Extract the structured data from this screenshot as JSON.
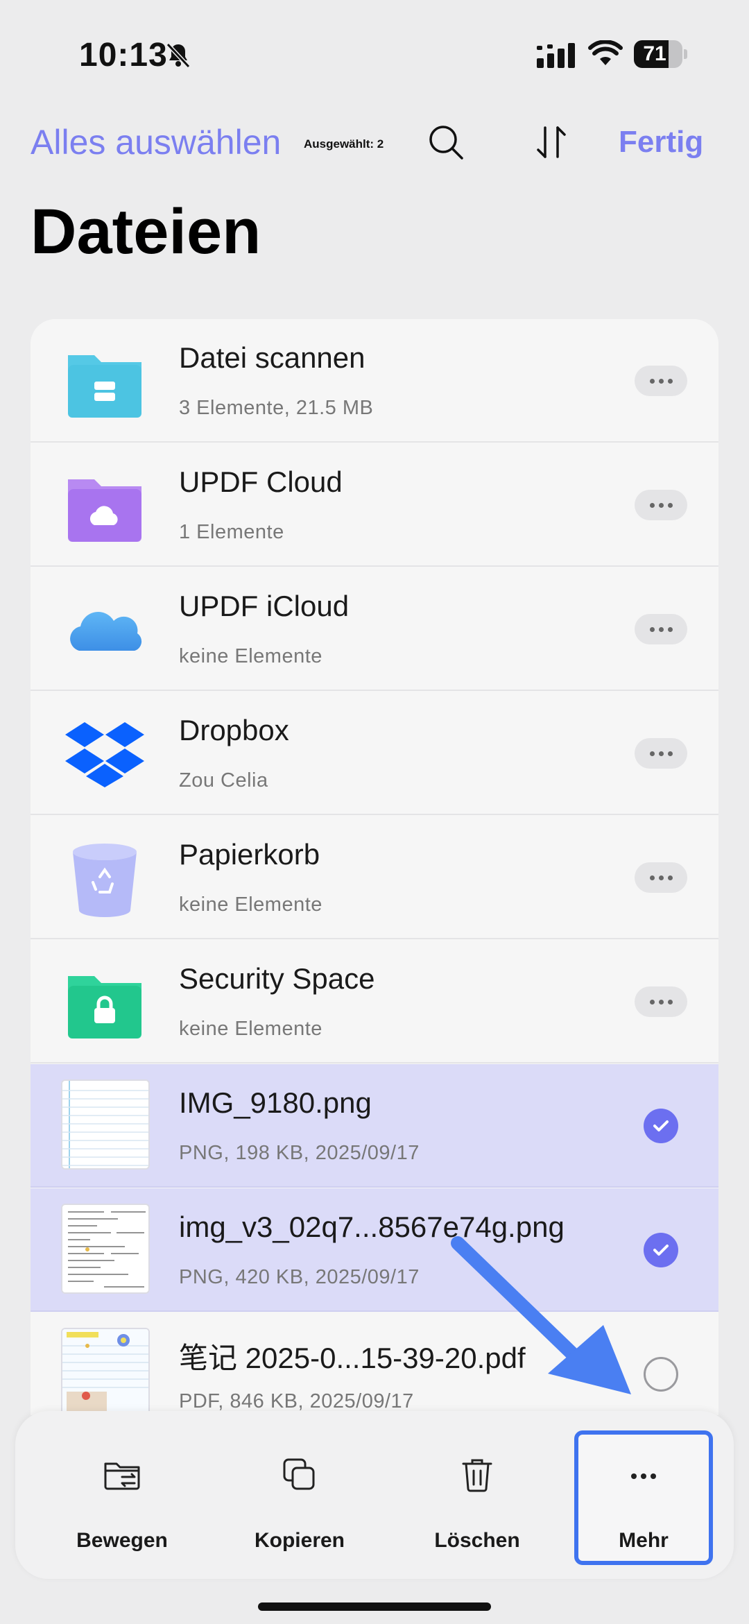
{
  "status": {
    "time": "10:13",
    "battery": "71",
    "battery_level": 0.71
  },
  "header": {
    "select_all": "Alles auswählen",
    "selected_count": "Ausgewählt: 2",
    "done": "Fertig",
    "title": "Dateien"
  },
  "rows": [
    {
      "title": "Datei scannen",
      "sub": "3 Elemente, 21.5 MB",
      "icon": "scan-folder-icon"
    },
    {
      "title": "UPDF Cloud",
      "sub": "1 Elemente",
      "icon": "cloud-folder-icon"
    },
    {
      "title": "UPDF iCloud",
      "sub": "keine Elemente",
      "icon": "icloud-icon"
    },
    {
      "title": "Dropbox",
      "sub": "Zou Celia",
      "icon": "dropbox-icon"
    },
    {
      "title": "Papierkorb",
      "sub": "keine Elemente",
      "icon": "trash-bin-icon"
    },
    {
      "title": "Security Space",
      "sub": "keine Elemente",
      "icon": "lock-folder-icon"
    },
    {
      "title": "IMG_9180.png",
      "sub": "PNG, 198 KB, 2025/09/17",
      "selected": true
    },
    {
      "title": "img_v3_02q7...8567e74g.png",
      "sub": "PNG, 420 KB, 2025/09/17",
      "selected": true
    },
    {
      "title": " 笔记 2025-0...15-39-20.pdf",
      "sub": "PDF, 846 KB, 2025/09/17",
      "selected": false
    }
  ],
  "toolbar": {
    "move": "Bewegen",
    "copy": "Kopieren",
    "delete": "Löschen",
    "more": "Mehr"
  },
  "colors": {
    "accent": "#7b7ff0",
    "selected_row": "#dbdbf8",
    "highlight_frame": "#3f73ef"
  }
}
